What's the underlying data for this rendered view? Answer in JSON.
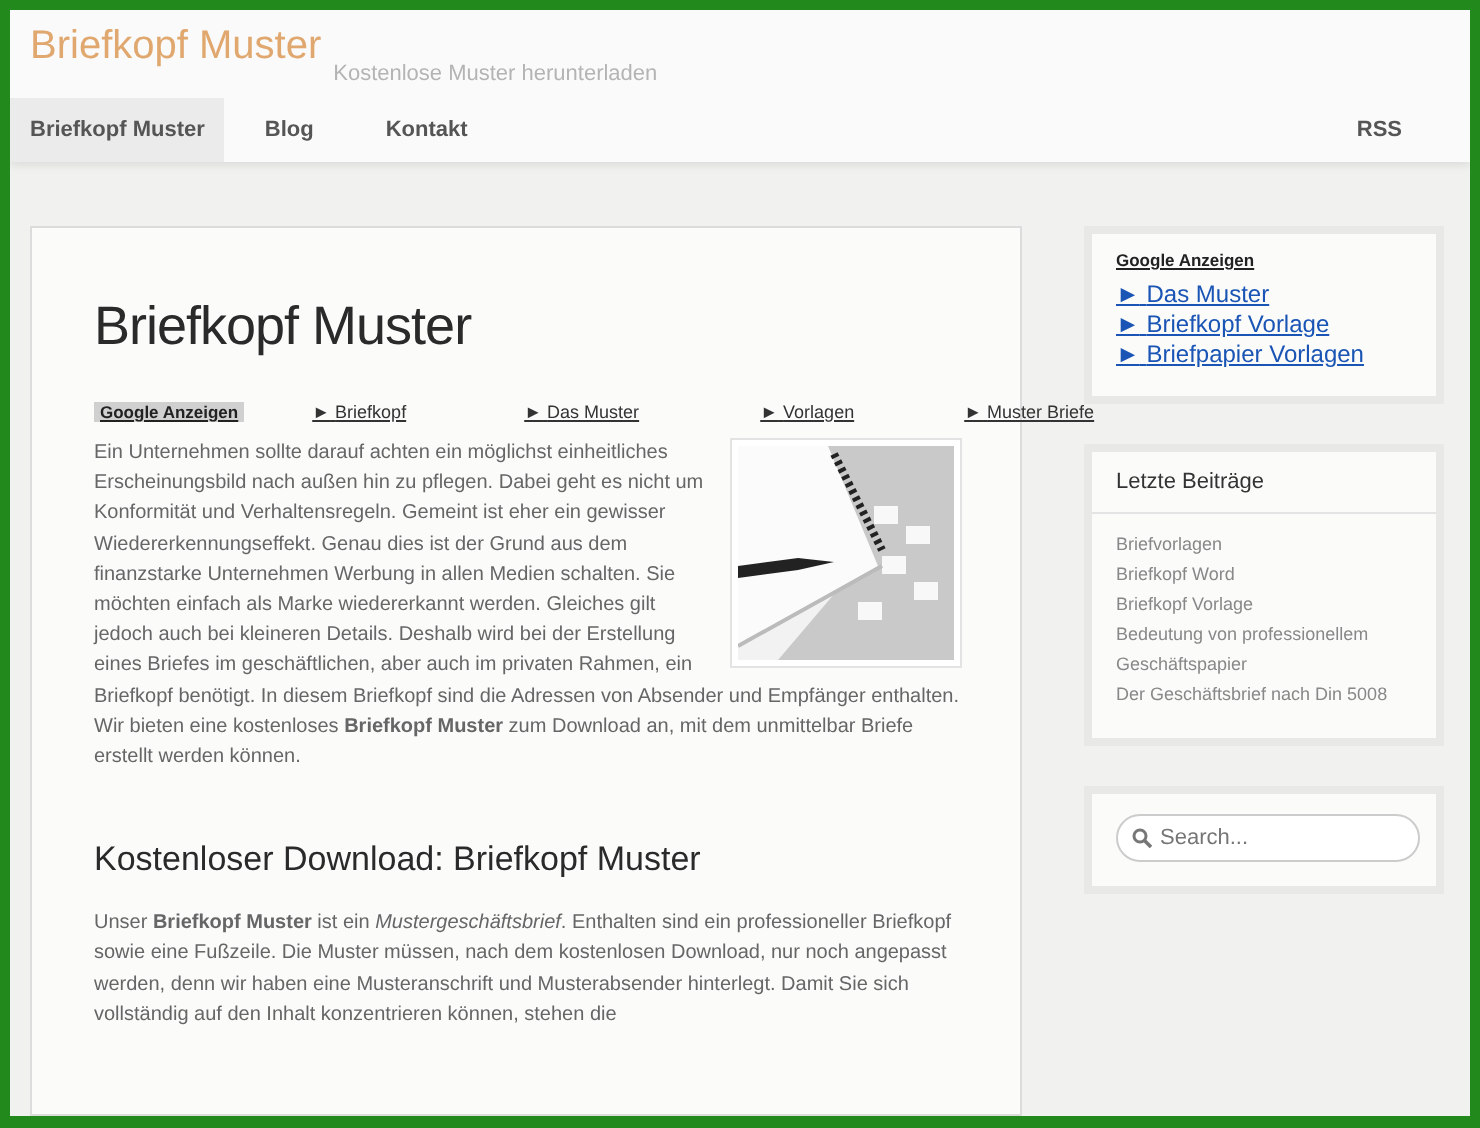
{
  "site": {
    "title": "Briefkopf Muster",
    "tagline": "Kostenlose Muster herunterladen"
  },
  "nav": {
    "items": [
      {
        "label": "Briefkopf Muster",
        "selected": true
      },
      {
        "label": "Blog",
        "selected": false
      },
      {
        "label": "Kontakt",
        "selected": false
      }
    ],
    "rss": "RSS"
  },
  "article": {
    "title": "Briefkopf Muster",
    "ads": {
      "label": "Google Anzeigen",
      "links": [
        {
          "arrow": "►",
          "text": "Briefkopf"
        },
        {
          "arrow": "►",
          "text": "Das Muster"
        },
        {
          "arrow": "►",
          "text": "Vorlagen"
        },
        {
          "arrow": "►",
          "text": "Muster Briefe"
        }
      ]
    },
    "intro": "Ein Unternehmen sollte darauf achten ein möglichst einheitliches Erscheinungsbild nach außen hin zu pflegen. Dabei geht es nicht um Konformität und Verhaltensregeln. Gemeint ist eher ein gewisser Wiedererkennungseffekt. Genau dies ist der Grund aus dem finanzstarke Unternehmen Werbung in allen Medien schalten. Sie möchten einfach als Marke wiedererkannt werden. Gleiches gilt jedoch auch bei kleineren Details. Deshalb wird bei der Erstellung eines Briefes im geschäftlichen, aber auch im privaten Rahmen, ein Briefkopf benötigt. In diesem Briefkopf sind die Adressen von Absender und Empfänger enthalten. Wir bieten eine kostenloses **Briefkopf Muster** zum Download an, mit dem unmittelbar Briefe erstellt werden können.",
    "subtitle": "Kostenloser Download: Briefkopf Muster",
    "body": "Unser **Briefkopf Muster** ist ein *Mustergeschäftsbrief*. Enthalten sind ein professioneller Briefkopf sowie eine Fußzeile. Die Muster müssen, nach dem kostenlosen Download, nur noch angepasst werden, denn wir haben eine Musteranschrift und Musterabsender hinterlegt. Damit Sie sich vollständig auf den Inhalt konzentrieren können, stehen die"
  },
  "sidebar": {
    "ads": {
      "label": "Google Anzeigen",
      "links": [
        {
          "arrow": "►",
          "text": "Das Muster"
        },
        {
          "arrow": "►",
          "text": "Briefkopf Vorlage"
        },
        {
          "arrow": "►",
          "text": "Briefpapier Vorlagen"
        }
      ]
    },
    "recent": {
      "title": "Letzte Beiträge",
      "items": [
        "Briefvorlagen",
        "Briefkopf Word",
        "Briefkopf Vorlage",
        "Bedeutung von professionellem Geschäftspapier",
        "Der Geschäftsbrief nach Din 5008"
      ]
    },
    "search": {
      "placeholder": "Search..."
    }
  }
}
